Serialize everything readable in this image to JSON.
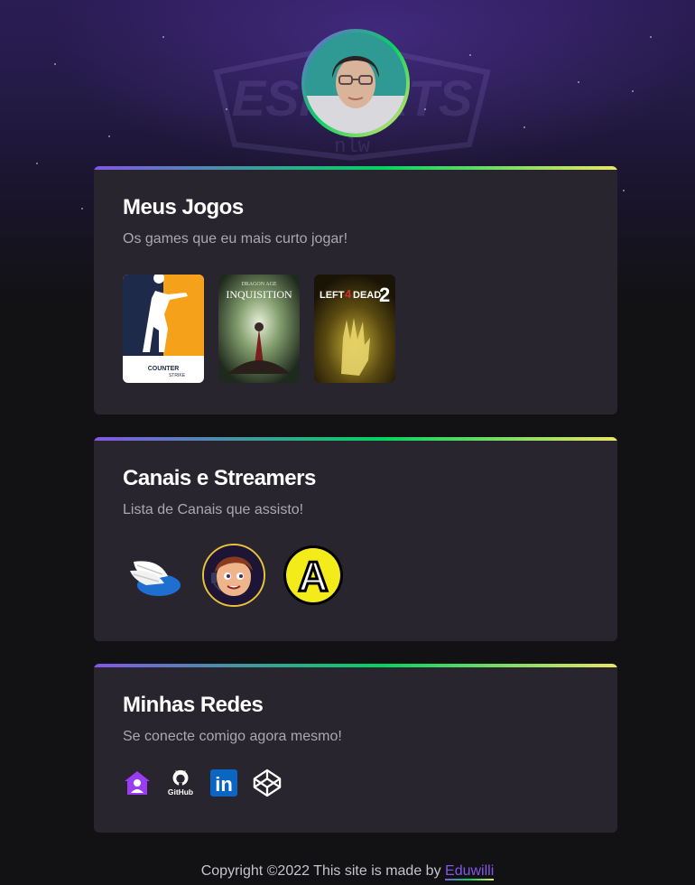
{
  "profile": {
    "avatar_alt": "Foto de perfil"
  },
  "watermark": {
    "text": "ESPORTS",
    "sub": "nlw"
  },
  "cards": {
    "games": {
      "title": "Meus Jogos",
      "subtitle": "Os games que eu mais curto jogar!",
      "items": [
        {
          "name": "Counter Strike",
          "logo_top": "COUNTER",
          "logo_bottom": "STRIKE"
        },
        {
          "name": "Dragon Age Inquisition",
          "logo_top": "DRAGON AGE",
          "logo_bottom": "INQUISITION"
        },
        {
          "name": "Left 4 Dead 2",
          "logo_top": "LEFT",
          "logo_mid": "4",
          "logo_bottom": "DEAD",
          "logo_num": "2"
        }
      ]
    },
    "streamers": {
      "title": "Canais e Streamers",
      "subtitle": "Lista de Canais que assisto!",
      "items": [
        {
          "name": "Winged shoe channel"
        },
        {
          "name": "Cartoon headset channel"
        },
        {
          "name": "A channel",
          "letter": "A"
        }
      ]
    },
    "socials": {
      "title": "Minhas Redes",
      "subtitle": "Se conecte comigo agora mesmo!",
      "items": [
        {
          "name": "Home",
          "icon": "home-icon",
          "color": "#9a3cf0"
        },
        {
          "name": "GitHub",
          "icon": "github-icon",
          "label": "GitHub"
        },
        {
          "name": "LinkedIn",
          "icon": "linkedin-icon",
          "label": "in",
          "color": "#0a66c2"
        },
        {
          "name": "CodePen",
          "icon": "codepen-icon"
        }
      ]
    }
  },
  "footer": {
    "text": "Copyright ©2022 This site is made by ",
    "link": "Eduwilli"
  },
  "colors": {
    "background": "#121214",
    "card": "#29252f",
    "accent_purple": "#8257e5",
    "accent_green": "#04d361",
    "accent_yellow": "#e9e666"
  }
}
